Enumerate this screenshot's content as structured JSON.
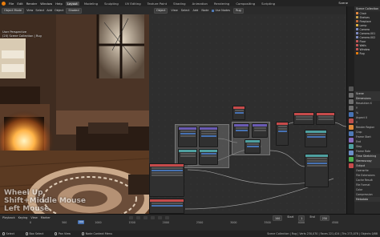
{
  "topbar": {
    "menus": [
      "File",
      "Edit",
      "Render",
      "Window",
      "Help"
    ],
    "workspaces": [
      "Layout",
      "Modeling",
      "Sculpting",
      "UV Editing",
      "Texture Paint",
      "Shading",
      "Animation",
      "Rendering",
      "Compositing",
      "Scripting"
    ],
    "active_workspace": "Layout",
    "scene": "Scene"
  },
  "viewport": {
    "mode": "Object Mode",
    "menus": [
      "View",
      "Select",
      "Add",
      "Object"
    ],
    "shading": "Shaded",
    "info_line1": "User Perspective",
    "info_line2": "(20) Scene Collection | Rug",
    "overlay_text": [
      "Wheel Up",
      "Shift+Middle Mouse",
      "Left Mouse"
    ]
  },
  "node_editor": {
    "menus": [
      "View",
      "Select",
      "Add",
      "Node"
    ],
    "use_nodes_label": "Use Nodes",
    "object_label": "Object",
    "material": "Rug"
  },
  "outliner": {
    "title": "Scene Collection",
    "items": [
      {
        "label": "Chair",
        "color": "#e68a3e"
      },
      {
        "label": "Shelves",
        "color": "#c9a24a"
      },
      {
        "label": "Fireplace",
        "color": "#c46b3b"
      },
      {
        "label": "Lamp",
        "color": "#e0b040"
      },
      {
        "label": "Camera",
        "color": "#7e8cc4"
      },
      {
        "label": "Camera.001",
        "color": "#7e8cc4"
      },
      {
        "label": "Camera.002",
        "color": "#7e8cc4"
      },
      {
        "label": "Floor",
        "color": "#c65757"
      },
      {
        "label": "Walls",
        "color": "#c65757"
      },
      {
        "label": "Window",
        "color": "#c65757"
      },
      {
        "label": "Rug",
        "color": "#e87d0d"
      }
    ]
  },
  "properties": {
    "scene_label": "Scene",
    "rows": [
      {
        "label": "Dimensions",
        "section": true
      },
      {
        "label": "Resolution X",
        "section": false
      },
      {
        "label": "Y",
        "section": false
      },
      {
        "label": "%",
        "section": false
      },
      {
        "label": "Aspect X",
        "section": false
      },
      {
        "label": "Y",
        "section": false
      },
      {
        "label": "Render Region",
        "section": false
      },
      {
        "label": "Crop",
        "section": false
      },
      {
        "label": "Frame Start",
        "section": false
      },
      {
        "label": "End",
        "section": false
      },
      {
        "label": "Step",
        "section": false
      },
      {
        "label": "Frame Rate",
        "section": false
      },
      {
        "label": "Time Stretching",
        "section": true
      },
      {
        "label": "Stereoscopy",
        "section": true
      },
      {
        "label": "Output",
        "section": true
      },
      {
        "label": "Overwrite",
        "section": false
      },
      {
        "label": "File Extensions",
        "section": false
      },
      {
        "label": "Cache Result",
        "section": false
      },
      {
        "label": "File Format",
        "section": false
      },
      {
        "label": "Color",
        "section": false
      },
      {
        "label": "Compression",
        "section": false
      },
      {
        "label": "Metadata",
        "section": true
      }
    ]
  },
  "timeline": {
    "menus": [
      "Playback",
      "Keying",
      "View",
      "Marker"
    ],
    "ticks": [
      "0",
      "500",
      "1000",
      "1500",
      "2000",
      "2500",
      "3000",
      "3500",
      "4000",
      "4500"
    ],
    "current_frame": "100",
    "start": "Start",
    "start_value": "1",
    "end": "End",
    "end_value": "250"
  },
  "statusbar": {
    "left1": "Select",
    "left2": "Box Select",
    "left3": "Pan View",
    "left4": "Node Context Menu",
    "stats": "Scene Collection | Rug | Verts 230,070 | Faces 221,424 | Tris 273,078 | Objects 0/88"
  }
}
